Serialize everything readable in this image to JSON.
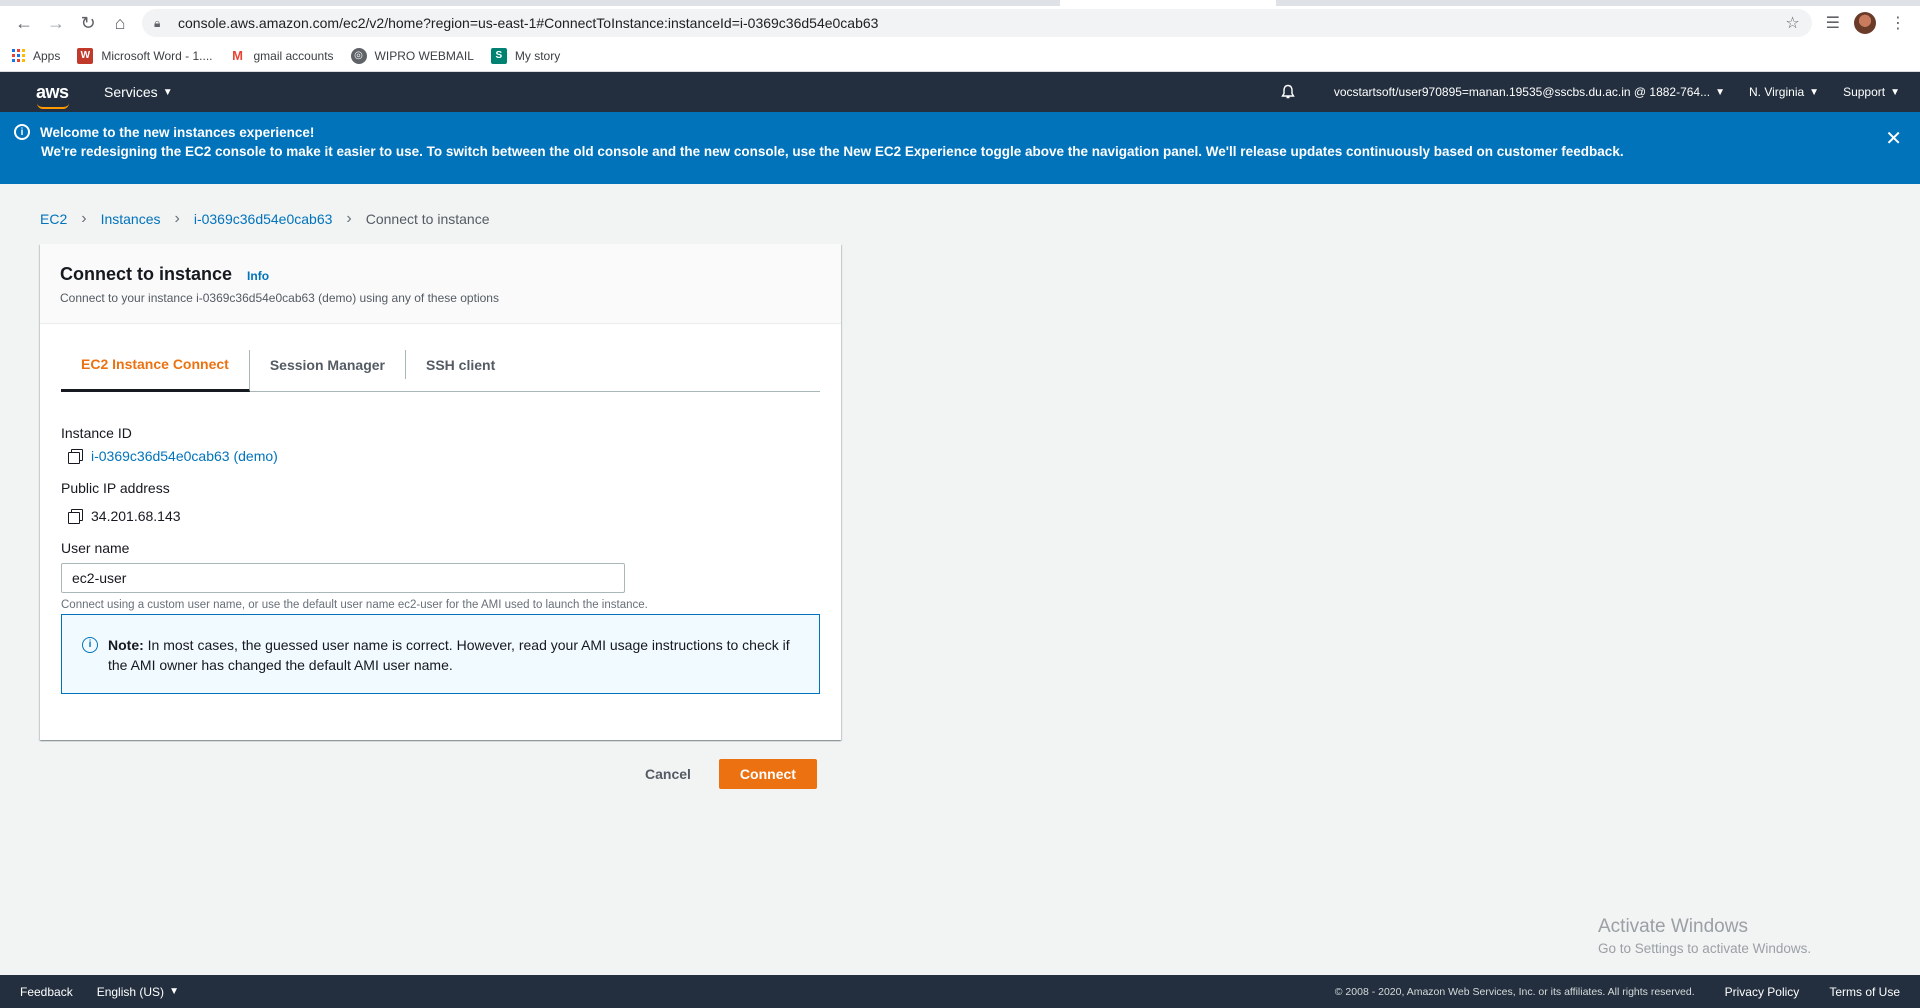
{
  "browser": {
    "url": "console.aws.amazon.com/ec2/v2/home?region=us-east-1#ConnectToInstance:instanceId=i-0369c36d54e0cab63",
    "bookmarks": [
      {
        "label": "Apps",
        "icon": "apps-grid-icon"
      },
      {
        "label": "Microsoft Word - 1....",
        "icon": "word-icon"
      },
      {
        "label": "gmail accounts",
        "icon": "gmail-icon"
      },
      {
        "label": "WIPRO WEBMAIL",
        "icon": "globe-icon"
      },
      {
        "label": "My story",
        "icon": "sway-icon"
      }
    ]
  },
  "awsnav": {
    "logo": "aws",
    "services": "Services",
    "account": "vocstartsoft/user970895=manan.19535@sscbs.du.ac.in @ 1882-764...",
    "region": "N. Virginia",
    "support": "Support"
  },
  "banner": {
    "title": "Welcome to the new instances experience!",
    "text": "We're redesigning the EC2 console to make it easier to use. To switch between the old console and the new console, use the New EC2 Experience toggle above the navigation panel. We'll release updates continuously based on customer feedback.",
    "close": "✕"
  },
  "breadcrumb": {
    "items": [
      "EC2",
      "Instances",
      "i-0369c36d54e0cab63"
    ],
    "current": "Connect to instance"
  },
  "panel": {
    "title": "Connect to instance",
    "info": "Info",
    "subtitle": "Connect to your instance i-0369c36d54e0cab63 (demo) using any of these options",
    "tabs": [
      "EC2 Instance Connect",
      "Session Manager",
      "SSH client"
    ],
    "instance_id_label": "Instance ID",
    "instance_id_value": "i-0369c36d54e0cab63 (demo)",
    "public_ip_label": "Public IP address",
    "public_ip_value": "34.201.68.143",
    "username_label": "User name",
    "username_value": "ec2-user",
    "username_hint": "Connect using a custom user name, or use the default user name ec2-user for the AMI used to launch the instance.",
    "note_bold": "Note:",
    "note_text": " In most cases, the guessed user name is correct. However, read your AMI usage instructions to check if the AMI owner has changed the default AMI user name."
  },
  "actions": {
    "cancel": "Cancel",
    "connect": "Connect"
  },
  "watermark": {
    "line1": "Activate Windows",
    "line2": "Go to Settings to activate Windows."
  },
  "footer": {
    "feedback": "Feedback",
    "language": "English (US)",
    "copyright": "© 2008 - 2020, Amazon Web Services, Inc. or its affiliates. All rights reserved.",
    "privacy": "Privacy Policy",
    "terms": "Terms of Use"
  },
  "colors": {
    "aws_nav": "#232f3e",
    "banner": "#0073bb",
    "accent_orange": "#ec7211",
    "link": "#0073bb"
  }
}
